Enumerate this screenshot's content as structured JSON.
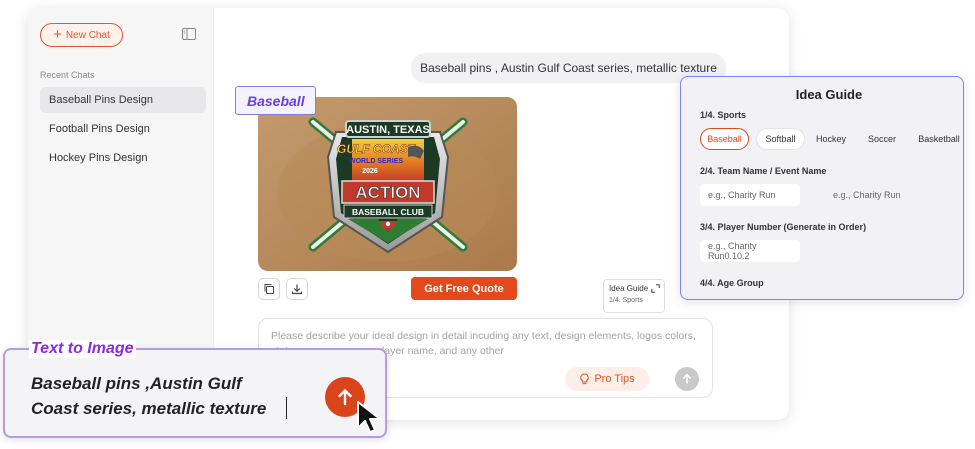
{
  "sidebar": {
    "new_chat_label": "New Chat",
    "recent_label": "Recent Chats",
    "items": [
      {
        "label": "Baseball Pins Design",
        "active": true
      },
      {
        "label": "Football Pins Design",
        "active": false
      },
      {
        "label": "Hockey Pins Design",
        "active": false
      }
    ]
  },
  "chat": {
    "user_message": "Baseball pins , Austin Gulf Coast series, metallic texture",
    "image_tag": "Baseball",
    "pin_text": {
      "top": "AUSTIN, TEXAS",
      "mid1": "GULF COAST",
      "mid2": "WORLD SERIES",
      "year": "2026",
      "name": "ACTION",
      "club": "BASEBALL CLUB"
    },
    "quote_button": "Get Free Quote",
    "idea_guide_mini_title": "Idea Guide",
    "idea_guide_mini_sub": "1/4. Sports"
  },
  "composer": {
    "placeholder": "Please describe your ideal design in detail incuding any text, design elements, logos colors, state map, age group, player name, and any other",
    "pro_tips_label": "Pro Tips"
  },
  "idea_guide": {
    "title": "Idea Guide",
    "q1": "1/4. Sports",
    "sports": [
      "Baseball",
      "Softball",
      "Hockey",
      "Soccer",
      "Basketball"
    ],
    "selected_sport": "Baseball",
    "q2": "2/4. Team Name / Event Name",
    "q2_placeholder_1": "e.g., Charity Run",
    "q2_placeholder_2": "e.g., Charity Run",
    "q3": "3/4. Player Number (Generate in Order)",
    "q3_placeholder": "e.g., Charity Run0.10.2",
    "q4": "4/4. Age Group"
  },
  "text_to_image": {
    "title": "Text to Image",
    "prompt_line1": "Baseball pins ,Austin Gulf",
    "prompt_line2": "Coast series, metallic texture"
  },
  "colors": {
    "accent": "#e2491c",
    "purple": "#8a2be2",
    "guide_border": "#7c86ef"
  }
}
